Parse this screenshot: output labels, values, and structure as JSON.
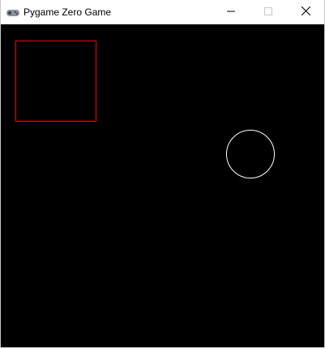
{
  "window": {
    "title": "Pygame Zero Game",
    "app_icon": "gamepad-icon",
    "controls": {
      "minimize_icon": "minimize-icon",
      "maximize_icon": "maximize-icon",
      "close_icon": "close-icon"
    }
  },
  "canvas": {
    "background_color": "#000000",
    "shapes": [
      {
        "kind": "rectangle-outline",
        "stroke_color": "#ff0000"
      },
      {
        "kind": "circle-outline",
        "stroke_color": "#ffffff"
      }
    ]
  }
}
